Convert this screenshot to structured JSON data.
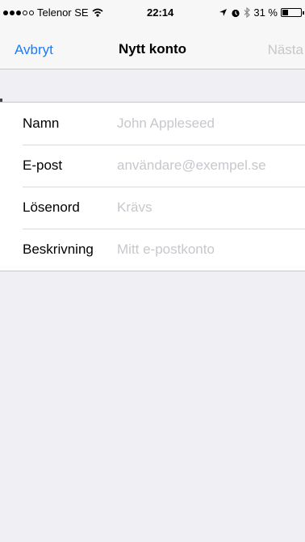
{
  "status_bar": {
    "carrier": "Telenor SE",
    "time": "22:14",
    "battery_percent": "31 %",
    "battery_level": 0.31,
    "signal_strength": 3,
    "signal_max": 5,
    "icons": [
      "wifi-icon",
      "location-icon",
      "alarm-icon",
      "bluetooth-icon",
      "battery-icon"
    ]
  },
  "nav": {
    "cancel_label": "Avbryt",
    "title": "Nytt konto",
    "next_label": "Nästa"
  },
  "form": {
    "fields": [
      {
        "label": "Namn",
        "placeholder": "John Appleseed",
        "value": ""
      },
      {
        "label": "E-post",
        "placeholder": "användare@exempel.se",
        "value": ""
      },
      {
        "label": "Lösenord",
        "placeholder": "Krävs",
        "value": ""
      },
      {
        "label": "Beskrivning",
        "placeholder": "Mitt e-postkonto",
        "value": ""
      }
    ]
  },
  "colors": {
    "accent": "#1a7cf7",
    "disabled": "#c7c7cc",
    "placeholder": "#c7c7cd",
    "background": "#efeff4"
  }
}
